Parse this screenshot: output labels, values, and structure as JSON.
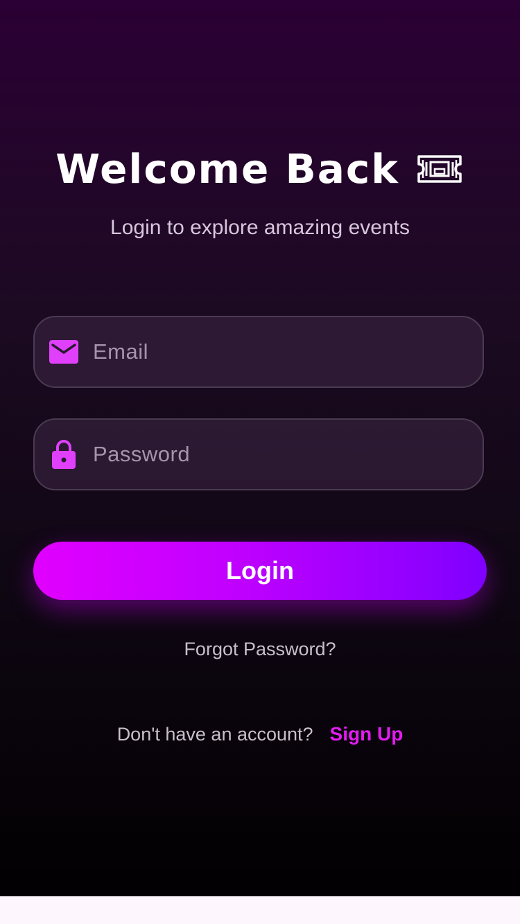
{
  "header": {
    "title": "Welcome Back",
    "title_icon": "ticket-icon",
    "subtitle": "Login to explore amazing events"
  },
  "form": {
    "email": {
      "placeholder": "Email",
      "value": "",
      "icon": "mail-icon"
    },
    "password": {
      "placeholder": "Password",
      "value": "",
      "icon": "lock-icon"
    },
    "login_label": "Login",
    "forgot_label": "Forgot Password?"
  },
  "footer": {
    "prompt": "Don't have an account?",
    "signup_label": "Sign Up"
  },
  "colors": {
    "accent": "#e100ff",
    "accent_end": "#7f00ff",
    "link": "#e31cf2",
    "icon": "#e040fb",
    "background_top": "#2b0034",
    "background_bottom": "#020002"
  }
}
